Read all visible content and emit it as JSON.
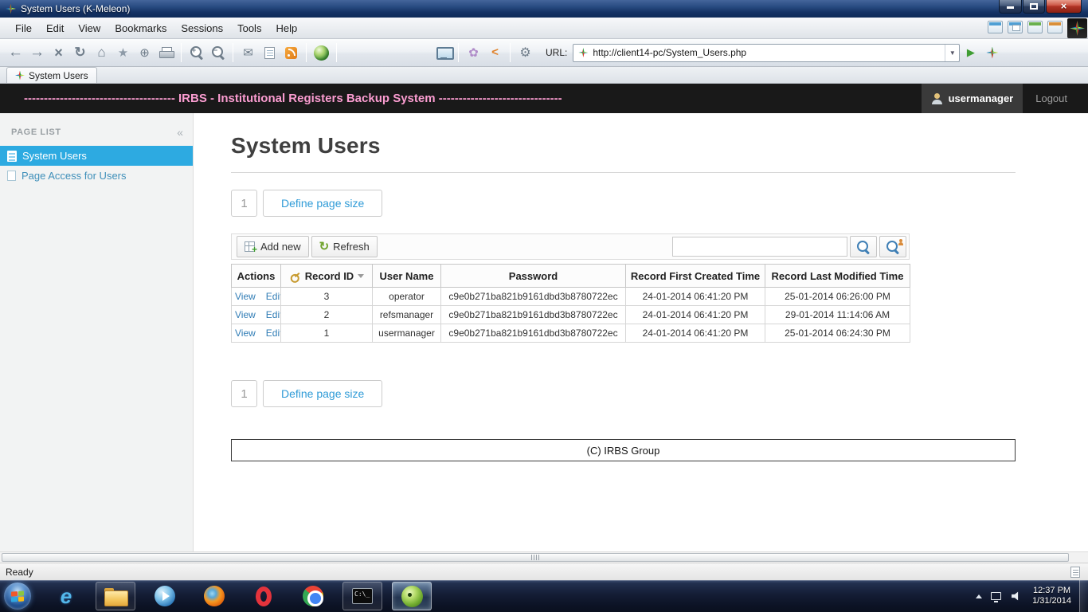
{
  "window": {
    "title": "System Users (K-Meleon)"
  },
  "menubar": {
    "items": [
      "File",
      "Edit",
      "View",
      "Bookmarks",
      "Sessions",
      "Tools",
      "Help"
    ]
  },
  "navbar": {
    "url_label": "URL:",
    "url_value": "http://client14-pc/System_Users.php"
  },
  "tabbar": {
    "active_tab": "System Users"
  },
  "banner": {
    "title": "-------------------------------------- IRBS - Institutional Registers Backup System -------------------------------",
    "username": "usermanager",
    "logout_label": "Logout"
  },
  "sidebar": {
    "header": "PAGE LIST",
    "items": [
      {
        "label": "System Users",
        "selected": true
      },
      {
        "label": "Page Access for Users",
        "selected": false
      }
    ]
  },
  "main": {
    "title": "System Users",
    "pager_top": {
      "page": "1",
      "define_label": "Define page size"
    },
    "pager_bottom": {
      "page": "1",
      "define_label": "Define page size"
    },
    "grid_toolbar": {
      "add_new_label": "Add new",
      "refresh_label": "Refresh",
      "search_value": ""
    },
    "table": {
      "headers": [
        "Actions",
        "Record ID",
        "User Name",
        "Password",
        "Record First Created Time",
        "Record Last Modified Time"
      ],
      "rows": [
        {
          "view": "View",
          "edit": "Edit",
          "record_id": "3",
          "user_name": "operator",
          "password": "c9e0b271ba821b9161dbd3b8780722ec",
          "created": "24-01-2014 06:41:20 PM",
          "modified": "25-01-2014 06:26:00 PM"
        },
        {
          "view": "View",
          "edit": "Edit",
          "record_id": "2",
          "user_name": "refsmanager",
          "password": "c9e0b271ba821b9161dbd3b8780722ec",
          "created": "24-01-2014 06:41:20 PM",
          "modified": "29-01-2014 11:14:06 AM"
        },
        {
          "view": "View",
          "edit": "Edit",
          "record_id": "1",
          "user_name": "usermanager",
          "password": "c9e0b271ba821b9161dbd3b8780722ec",
          "created": "24-01-2014 06:41:20 PM",
          "modified": "25-01-2014 06:24:30 PM"
        }
      ]
    },
    "footer": "(C) IRBS Group"
  },
  "statusbar": {
    "text": "Ready"
  },
  "taskbar": {
    "clock": {
      "time": "12:37 PM",
      "date": "1/31/2014"
    }
  },
  "icons": {
    "back": "←",
    "forward": "→",
    "stop": "×",
    "reload": "↻",
    "home": "⌂",
    "bookmarks": "★",
    "add-bookmark": "⊕",
    "print": "printer-shape",
    "zoom-in": "magnifier-plus",
    "zoom-out": "magnifier-minus",
    "mail": "✉",
    "notes": "page-lines",
    "rss": "rss-square",
    "browser": "globe",
    "settings": "⚙",
    "go": "▶",
    "search": "magnifier",
    "advanced-search": "magnifier-user",
    "primary-key": "key",
    "sort": "▾",
    "collapse-sidebar": "«",
    "user": "person-silhouette",
    "kmeleon": "pinwheel"
  },
  "colors": {
    "accent_blue": "#2daae1",
    "link_blue": "#2f7cb5",
    "banner_pink": "#fb9dd1",
    "banner_bg": "#191919",
    "titlebar_blue": "#274a80",
    "close_red": "#b03325"
  }
}
